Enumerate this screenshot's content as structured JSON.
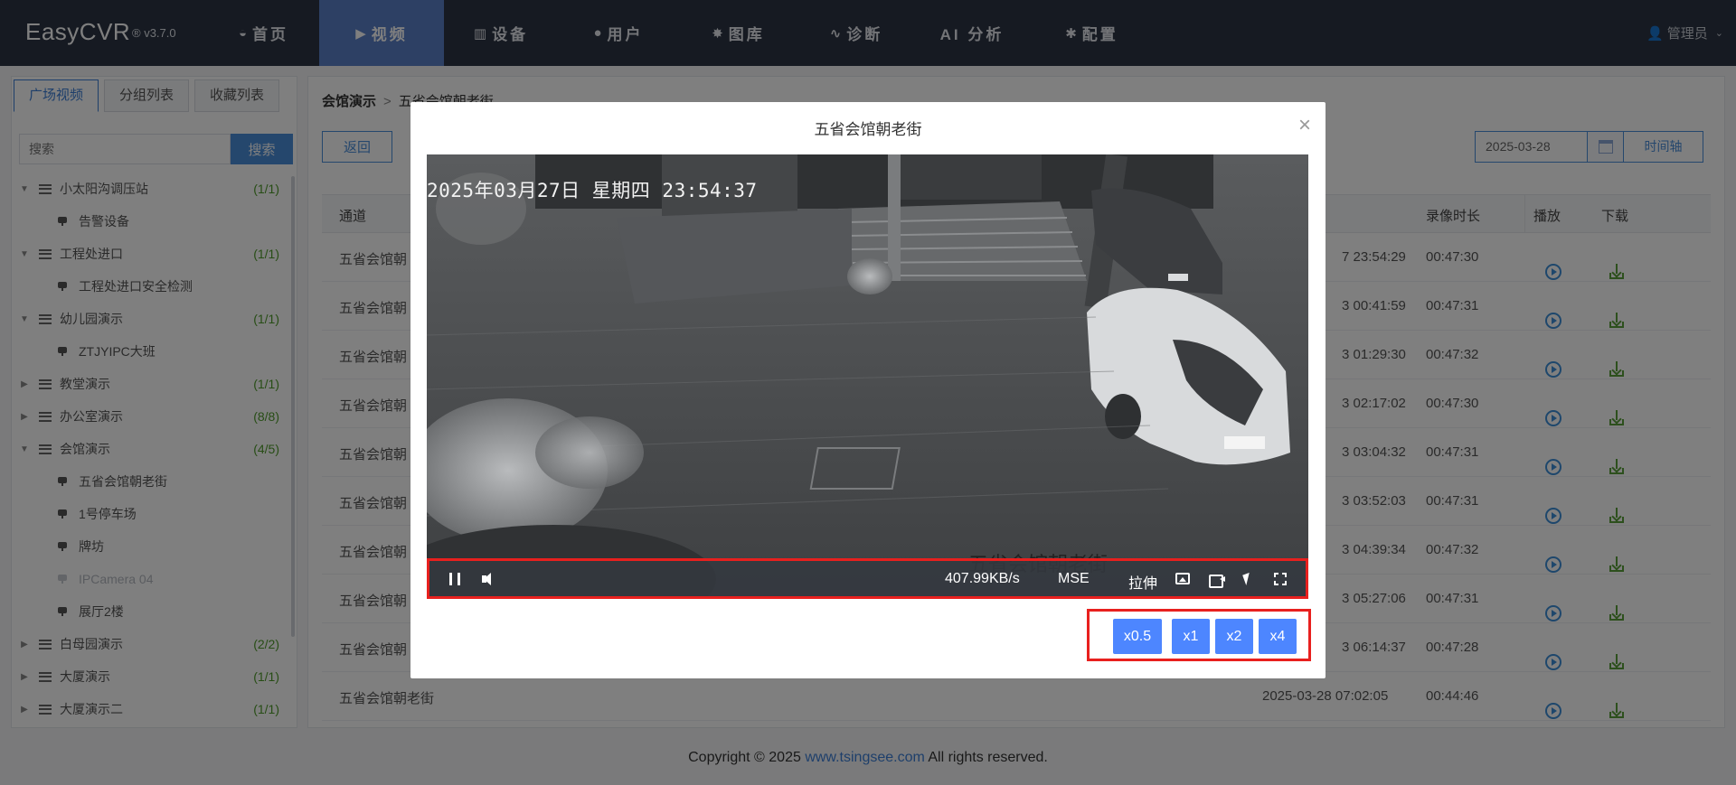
{
  "app": {
    "brand": "EasyCVR",
    "version": "® v3.7.0",
    "user": "管理员"
  },
  "nav": [
    {
      "label": "首页",
      "icon": "dashboard-icon",
      "glyph": "◒",
      "active": false
    },
    {
      "label": "视频",
      "icon": "play-circle-icon",
      "glyph": "▶",
      "active": true
    },
    {
      "label": "设备",
      "icon": "device-icon",
      "glyph": "▥",
      "active": false
    },
    {
      "label": "用户",
      "icon": "user-icon",
      "glyph": "●",
      "active": false
    },
    {
      "label": "图库",
      "icon": "gallery-icon",
      "glyph": "✸",
      "active": false
    },
    {
      "label": "诊断",
      "icon": "pulse-icon",
      "glyph": "∿",
      "active": false
    },
    {
      "label": "AI 分析",
      "icon": "",
      "glyph": "",
      "active": false
    },
    {
      "label": "配置",
      "icon": "gear-icon",
      "glyph": "✱",
      "active": false
    }
  ],
  "sidebar": {
    "tabs": [
      "广场视频",
      "分组列表",
      "收藏列表"
    ],
    "search": {
      "placeholder": "搜索",
      "button": "搜索"
    },
    "tree": [
      {
        "type": "group",
        "name": "小太阳沟调压站",
        "count": "(1/1)",
        "expanded": true
      },
      {
        "type": "device",
        "name": "告警设备",
        "online": true
      },
      {
        "type": "group",
        "name": "工程处进口",
        "count": "(1/1)",
        "expanded": true
      },
      {
        "type": "device",
        "name": "工程处进口安全检测",
        "online": true
      },
      {
        "type": "group",
        "name": "幼儿园演示",
        "count": "(1/1)",
        "expanded": true
      },
      {
        "type": "device",
        "name": "ZTJYIPC大班",
        "online": true
      },
      {
        "type": "group",
        "name": "教堂演示",
        "count": "(1/1)",
        "expanded": false
      },
      {
        "type": "group",
        "name": "办公室演示",
        "count": "(8/8)",
        "expanded": false
      },
      {
        "type": "group",
        "name": "会馆演示",
        "count": "(4/5)",
        "expanded": true
      },
      {
        "type": "device",
        "name": "五省会馆朝老街",
        "online": true
      },
      {
        "type": "device",
        "name": "1号停车场",
        "online": true
      },
      {
        "type": "device",
        "name": "牌坊",
        "online": true
      },
      {
        "type": "device",
        "name": "IPCamera 04",
        "online": false
      },
      {
        "type": "device",
        "name": "展厅2楼",
        "online": true
      },
      {
        "type": "group",
        "name": "白母园演示",
        "count": "(2/2)",
        "expanded": false
      },
      {
        "type": "group",
        "name": "大厦演示",
        "count": "(1/1)",
        "expanded": false
      },
      {
        "type": "group",
        "name": "大厦演示二",
        "count": "(1/1)",
        "expanded": false
      }
    ]
  },
  "main": {
    "breadcrumb": {
      "root": "会馆演示",
      "sep": ">",
      "current": "五省会馆朝老街"
    },
    "back_button": "返回",
    "date": "2025-03-28",
    "timeline_button": "时间轴",
    "table": {
      "headers": {
        "channel": "通道",
        "duration": "录像时长",
        "play": "播放",
        "download": "下载"
      },
      "rows": [
        {
          "channel": "五省会馆朝",
          "end": "7 23:54:29",
          "duration": "00:47:30"
        },
        {
          "channel": "五省会馆朝",
          "end": "3 00:41:59",
          "duration": "00:47:31"
        },
        {
          "channel": "五省会馆朝",
          "end": "3 01:29:30",
          "duration": "00:47:32"
        },
        {
          "channel": "五省会馆朝",
          "end": "3 02:17:02",
          "duration": "00:47:30"
        },
        {
          "channel": "五省会馆朝",
          "end": "3 03:04:32",
          "duration": "00:47:31"
        },
        {
          "channel": "五省会馆朝",
          "end": "3 03:52:03",
          "duration": "00:47:31"
        },
        {
          "channel": "五省会馆朝",
          "end": "3 04:39:34",
          "duration": "00:47:32"
        },
        {
          "channel": "五省会馆朝",
          "end": "3 05:27:06",
          "duration": "00:47:31"
        },
        {
          "channel": "五省会馆朝",
          "end": "3 06:14:37",
          "duration": "00:47:28"
        },
        {
          "channel": "五省会馆朝老街",
          "end": "2025-03-28 07:02:05",
          "duration": "00:44:46"
        }
      ]
    }
  },
  "footer": {
    "prefix": "Copyright © 2025 ",
    "link": "www.tsingsee.com",
    "suffix": " All rights reserved."
  },
  "modal": {
    "title": "五省会馆朝老街",
    "close": "×",
    "osd": "2025年03月27日 星期四 23:54:37",
    "watermark": "五省会馆朝老街",
    "controls": {
      "bitrate": "407.99KB/s",
      "protocol": "MSE",
      "stretch": "拉伸"
    },
    "speeds": [
      "x0.5",
      "x1",
      "x2",
      "x4"
    ]
  },
  "colors": {
    "nav_bg": "#2c3444",
    "nav_active": "#5b80c9",
    "accent": "#4a8edb",
    "speed_btn": "#4d86ff",
    "highlight": "#e8201e",
    "count_green": "#4e9a2a"
  }
}
